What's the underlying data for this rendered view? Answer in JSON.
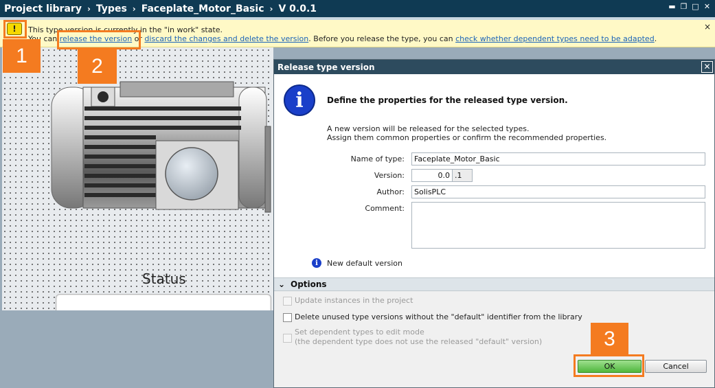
{
  "titlebar": {
    "crumbs": [
      "Project library",
      "Types",
      "Faceplate_Motor_Basic",
      "V 0.0.1"
    ]
  },
  "banner": {
    "line1": "This type version is currently in the \"in work\" state.",
    "prefix": "You can ",
    "link_release": "release the version",
    "or_text": " or ",
    "link_discard": "discard the changes and delete the version",
    "middle_text": ". Before you release the type, you can ",
    "link_check": "check whether dependent types need to be adapted",
    "suffix": ".",
    "close": "×"
  },
  "warning_icon_glyph": "!",
  "steps": {
    "s1": "1",
    "s2": "2",
    "s3": "3"
  },
  "canvas": {
    "status_label": "Status"
  },
  "dialog": {
    "title": "Release type version",
    "close_glyph": "✕",
    "heading": "Define the properties for the released type version.",
    "desc_line1": "A new version will be released for the selected types.",
    "desc_line2": "Assign them common properties or confirm the recommended properties.",
    "name_label": "Name of type:",
    "name_value": "Faceplate_Motor_Basic",
    "version_label": "Version:",
    "version_major": "0.0",
    "version_minor": ".1",
    "author_label": "Author:",
    "author_value": "SolisPLC",
    "comment_label": "Comment:",
    "comment_value": "",
    "new_default": "New default version",
    "options_header": "Options",
    "opt_update": "Update instances in the project",
    "opt_delete": "Delete unused type versions without the \"default\" identifier from the library",
    "opt_edit_line1": "Set dependent types to edit mode",
    "opt_edit_line2": "(the dependent type does not use the released \"default\" version)",
    "ok": "OK",
    "cancel": "Cancel"
  },
  "colors": {
    "accent_orange": "#f47b20",
    "titlebar": "#0f3a53",
    "ok_green": "#4fb63d",
    "info_blue": "#1a3fc9"
  }
}
